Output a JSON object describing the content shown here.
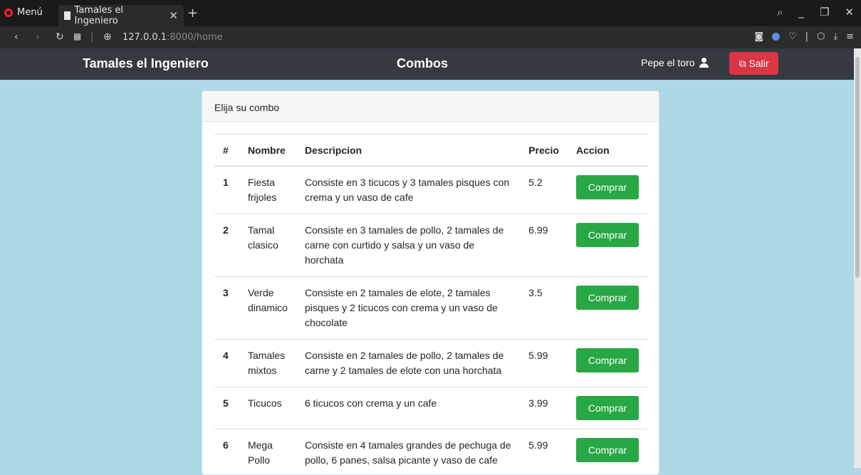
{
  "browser": {
    "menu_label": "Menú",
    "tab_title": "Tamales el Ingeniero",
    "url_host": "127.0.0.1",
    "url_path": ":8000/home"
  },
  "navbar": {
    "brand": "Tamales el Ingeniero",
    "title": "Combos",
    "user": "Pepe el toro",
    "logout": "Salir"
  },
  "card": {
    "header": "Elija su combo",
    "columns": [
      "#",
      "Nombre",
      "Descripcion",
      "Precio",
      "Accion"
    ],
    "button_label": "Comprar",
    "rows": [
      {
        "id": "1",
        "name": "Fiesta frijoles",
        "desc": "Consiste en 3 ticucos y 3 tamales pisques con crema y un vaso de cafe",
        "price": "5.2"
      },
      {
        "id": "2",
        "name": "Tamal clasico",
        "desc": "Consiste en 3 tamales de pollo, 2 tamales de carne con curtido y salsa y un vaso de horchata",
        "price": "6.99"
      },
      {
        "id": "3",
        "name": "Verde dinamico",
        "desc": "Consiste en 2 tamales de elote, 2 tamales pisques y 2 ticucos con crema y un vaso de chocolate",
        "price": "3.5"
      },
      {
        "id": "4",
        "name": "Tamales mixtos",
        "desc": "Consiste en 2 tamales de pollo, 2 tamales de carne y 2 tamales de elote con una horchata",
        "price": "5.99"
      },
      {
        "id": "5",
        "name": "Ticucos",
        "desc": "6 ticucos con crema y un cafe",
        "price": "3.99"
      },
      {
        "id": "6",
        "name": "Mega Pollo",
        "desc": "Consiste en 4 tamales grandes de pechuga de pollo, 6 panes, salsa picante y vaso de cafe",
        "price": "5.99"
      }
    ]
  },
  "colors": {
    "page_bg": "#add8e6",
    "navbar_bg": "#343a40",
    "danger": "#dc3545",
    "success": "#28a745"
  }
}
